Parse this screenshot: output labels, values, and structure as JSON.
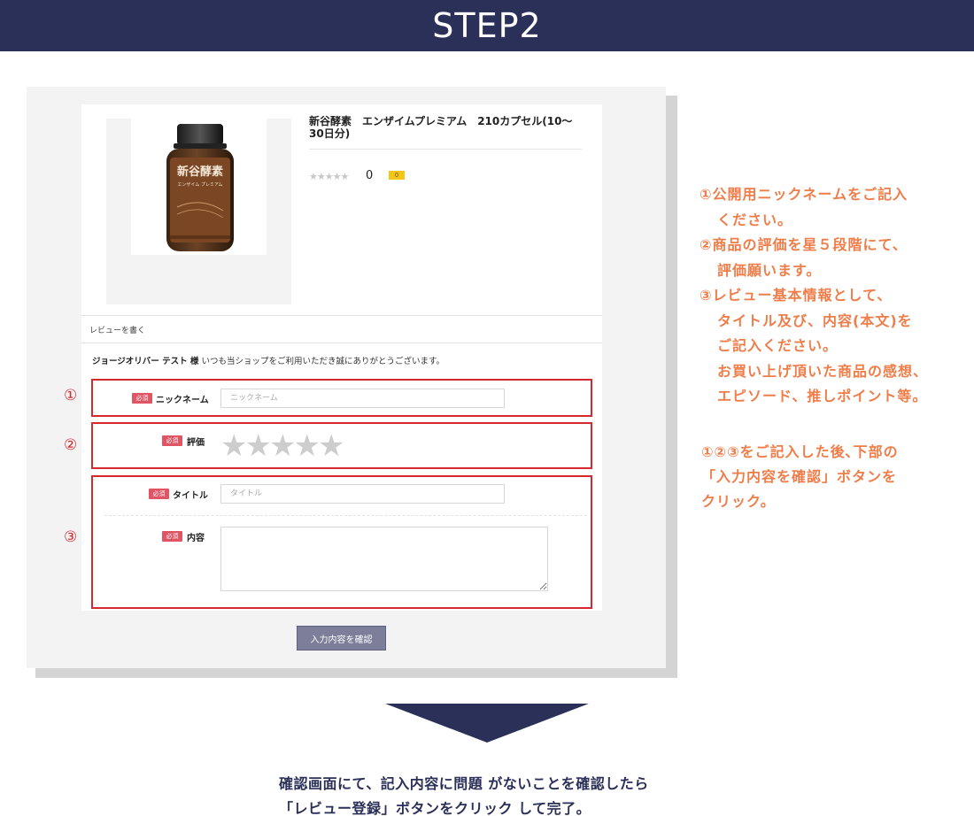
{
  "banner": {
    "title": "STEP2"
  },
  "product": {
    "name": "新谷酵素　エンザイムプレミアム　210カプセル(10〜30日分)",
    "label_text": "新谷酵素",
    "label_sub": "エンザイム プレミアム",
    "rating_stars": "★★★★★",
    "rating_count": "0",
    "comment_badge": "0"
  },
  "review": {
    "heading": "レビューを書く",
    "user_name": "ジョージオリバー テスト 様",
    "greeting": "いつも当ショップをご利用いただき誠にありがとうございます。",
    "required_label": "必須",
    "nickname_label": "ニックネーム",
    "nickname_placeholder": "ニックネーム",
    "rating_label": "評価",
    "title_label": "タイトル",
    "title_placeholder": "タイトル",
    "content_label": "内容",
    "confirm_button": "入力内容を確認"
  },
  "markers": [
    "①",
    "②",
    "③"
  ],
  "instructions": {
    "lines": [
      "①公開用ニックネームをご記入",
      "ください。",
      "②商品の評価を星５段階にて、",
      "評価願います。",
      "③レビュー基本情報として、",
      "タイトル及び、内容(本文)を",
      "ご記入ください。",
      "お買い上げ頂いた商品の感想、",
      "エピソード、推しポイント等。"
    ],
    "after_lines": [
      "①②③をご記入した後､下部の",
      "「入力内容を確認」ボタンを",
      "クリック。"
    ]
  },
  "footer": {
    "line1": "確認画面にて、記入内容に問題 がないことを確認したら",
    "line2": "「レビュー登録」ボタンをクリック して完了。"
  },
  "colors": {
    "navy": "#2b3059",
    "orange": "#ef7d49",
    "red": "#d6282f",
    "badge": "#e05463"
  }
}
